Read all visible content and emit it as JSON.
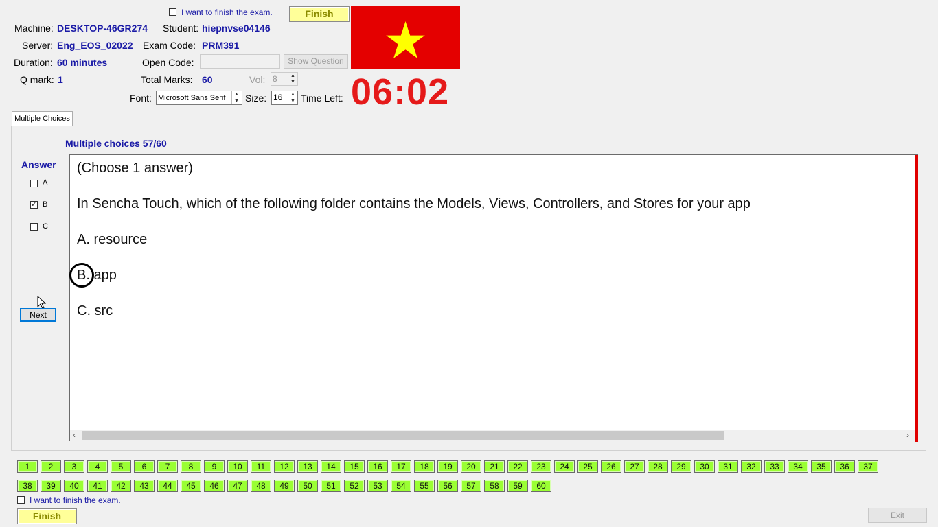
{
  "header": {
    "finish_checkbox_label": "I want to finish the exam.",
    "finish_button": "Finish",
    "machine_label": "Machine:",
    "machine_value": "DESKTOP-46GR274",
    "student_label": "Student:",
    "student_value": "hiepnvse04146",
    "server_label": "Server:",
    "server_value": "Eng_EOS_02022",
    "exam_code_label": "Exam Code:",
    "exam_code_value": "PRM391",
    "duration_label": "Duration:",
    "duration_value": "60 minutes",
    "open_code_label": "Open Code:",
    "open_code_value": "",
    "show_question_button": "Show Question",
    "qmark_label": "Q mark:",
    "qmark_value": "1",
    "total_marks_label": "Total Marks:",
    "total_marks_value": "60",
    "vol_label": "Vol:",
    "vol_value": "8",
    "font_label": "Font:",
    "font_value": "Microsoft Sans Serif",
    "size_label": "Size:",
    "size_value": "16",
    "time_left_label": "Time Left:",
    "time_left_value": "06:02",
    "flag_colors": {
      "background": "#e40000",
      "star": "#ffff00"
    }
  },
  "tabs": [
    {
      "label": "Multiple Choices"
    }
  ],
  "question": {
    "counter": "Multiple choices 57/60",
    "answer_heading": "Answer",
    "options": [
      {
        "key": "A",
        "checked": false
      },
      {
        "key": "B",
        "checked": true
      },
      {
        "key": "C",
        "checked": false
      }
    ],
    "next_button": "Next",
    "lines": [
      "(Choose 1 answer)",
      "In Sencha Touch, which of the following folder contains the Models, Views, Controllers, and Stores for your app",
      "A.  resource",
      "B.  app",
      "C.  src"
    ]
  },
  "question_numbers": [
    "1",
    "2",
    "3",
    "4",
    "5",
    "6",
    "7",
    "8",
    "9",
    "10",
    "11",
    "12",
    "13",
    "14",
    "15",
    "16",
    "17",
    "18",
    "19",
    "20",
    "21",
    "22",
    "23",
    "24",
    "25",
    "26",
    "27",
    "28",
    "29",
    "30",
    "31",
    "32",
    "33",
    "34",
    "35",
    "36",
    "37",
    "38",
    "39",
    "40",
    "41",
    "42",
    "43",
    "44",
    "45",
    "46",
    "47",
    "48",
    "49",
    "50",
    "51",
    "52",
    "53",
    "54",
    "55",
    "56",
    "57",
    "58",
    "59",
    "60"
  ],
  "footer": {
    "finish_checkbox_label": "I want to finish the exam.",
    "finish_button": "Finish",
    "exit_button": "Exit"
  }
}
